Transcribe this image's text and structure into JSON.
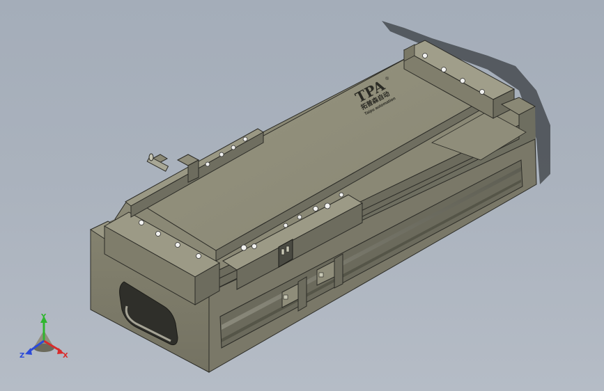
{
  "app": {
    "view": "cad-3d-viewport"
  },
  "model": {
    "logo": {
      "mark": "TPA",
      "registered": "®",
      "chinese": "拓普森自动",
      "tagline": "Taipu automation"
    },
    "colors": {
      "background_top": "#a4adb9",
      "background_bottom": "#b5bcc6",
      "body_top": "#8e8c7a",
      "body_front": "#7d7b6b",
      "body_side": "#6a6a5c",
      "edge": "#2b2b26"
    }
  },
  "triad": {
    "axes": [
      {
        "label": "Y",
        "color": "#2fb62f"
      },
      {
        "label": "X",
        "color": "#d92b2b"
      },
      {
        "label": "Z",
        "color": "#2b4ad9"
      }
    ]
  }
}
